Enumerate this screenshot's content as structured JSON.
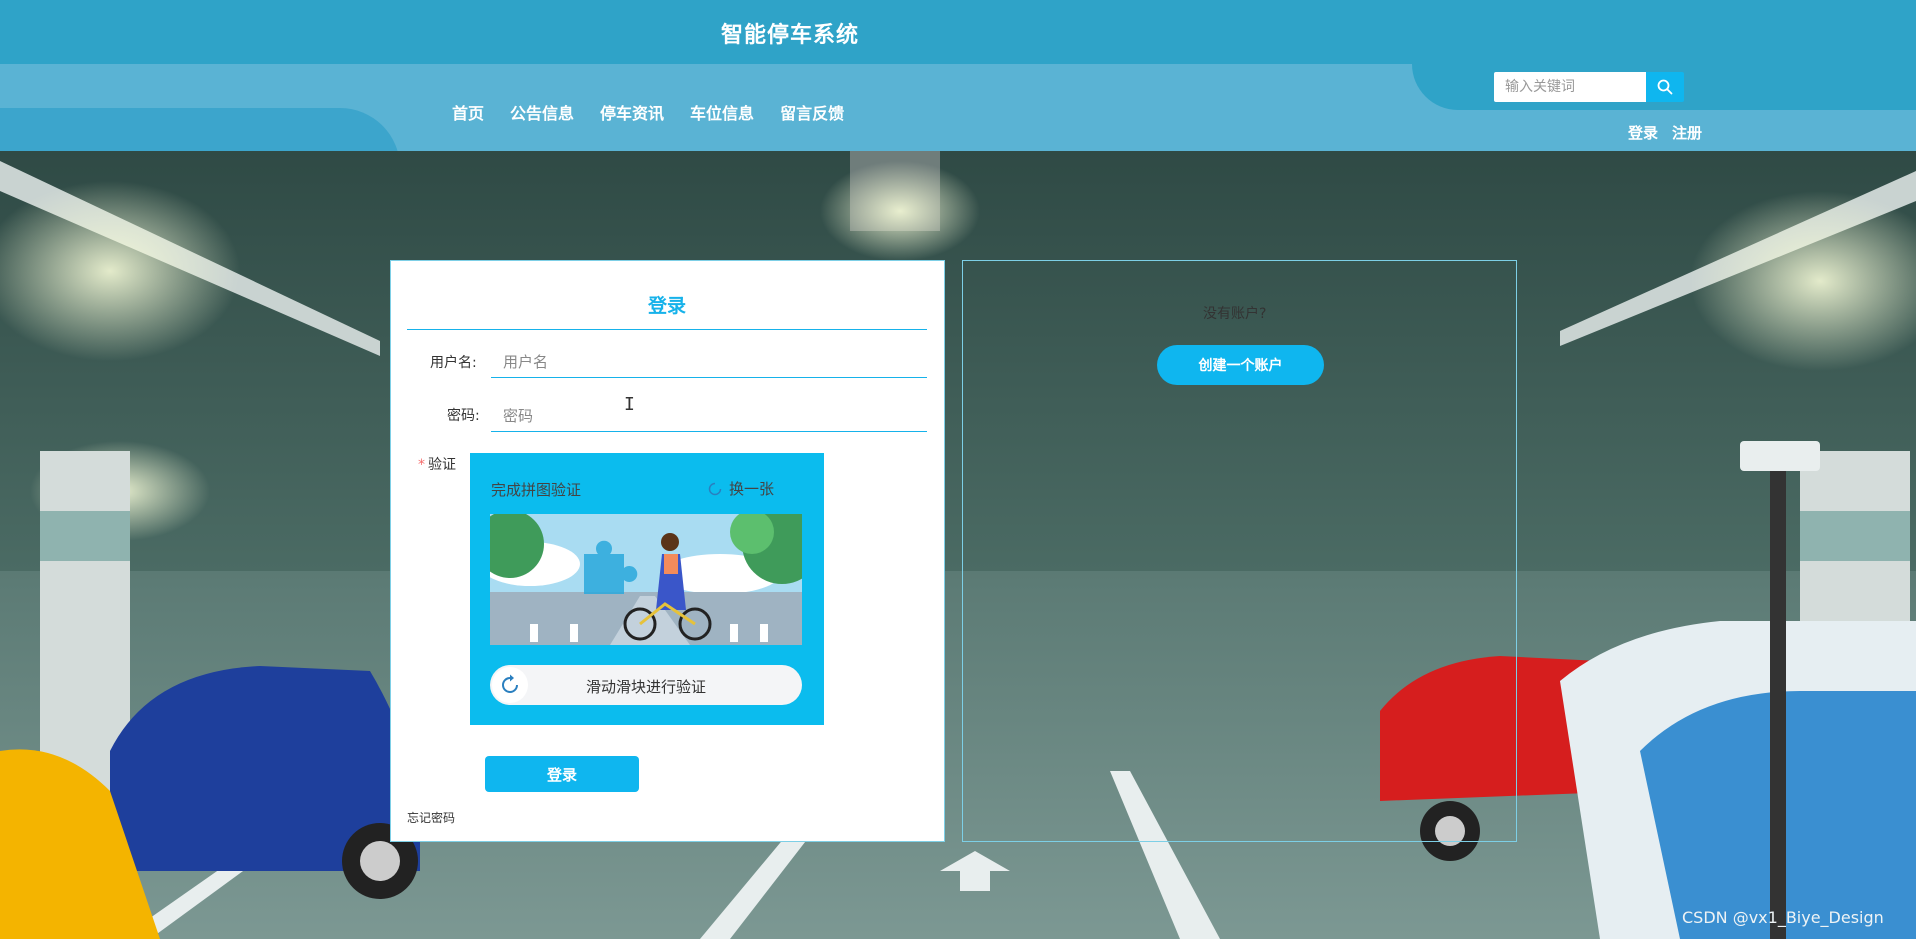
{
  "header": {
    "site_title": "智能停车系统",
    "nav": [
      "首页",
      "公告信息",
      "停车资讯",
      "车位信息",
      "留言反馈"
    ],
    "search_placeholder": "输入关键词",
    "login_link": "登录",
    "register_link": "注册"
  },
  "login_form": {
    "heading": "登录",
    "username_label": "用户名:",
    "username_placeholder": "用户名",
    "password_label": "密码:",
    "password_placeholder": "密码",
    "verify_required_mark": "*",
    "verify_label": "验证",
    "captcha": {
      "title": "完成拼图验证",
      "refresh_label": "换一张",
      "slider_text": "滑动滑块进行验证"
    },
    "submit_label": "登录",
    "forgot_password": "忘记密码"
  },
  "signup_panel": {
    "prompt": "没有账户?",
    "create_button": "创建一个账户"
  },
  "watermark": "CSDN @vx1_Biye_Design",
  "colors": {
    "header_bg": "#2fa3c8",
    "nav_bg": "#5ab3d4",
    "accent": "#0fb6ef",
    "heading": "#16b2ea"
  },
  "icons": [
    "search-icon",
    "refresh-icon",
    "slider-refresh-icon"
  ]
}
